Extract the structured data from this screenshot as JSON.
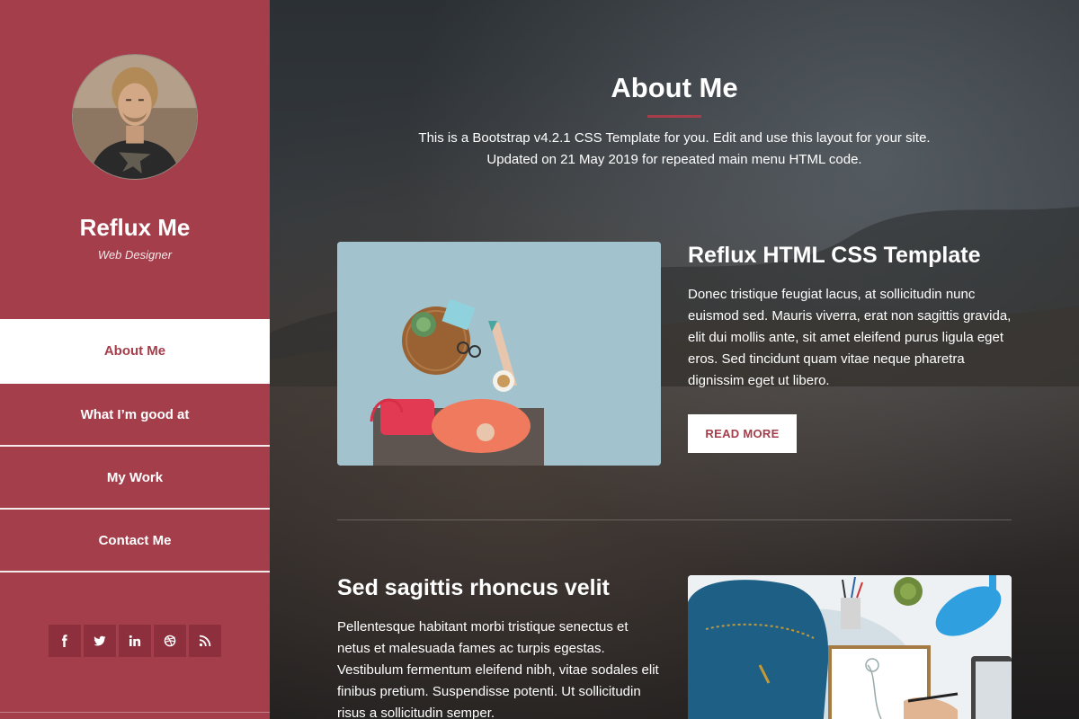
{
  "sidebar": {
    "name": "Reflux Me",
    "role": "Web Designer",
    "nav": [
      {
        "label": "About Me",
        "active": true
      },
      {
        "label": "What I’m good at",
        "active": false
      },
      {
        "label": "My Work",
        "active": false
      },
      {
        "label": "Contact Me",
        "active": false
      }
    ],
    "social_icons": [
      "facebook-icon",
      "twitter-icon",
      "linkedin-icon",
      "dribbble-icon",
      "rss-icon"
    ]
  },
  "main": {
    "title": "About Me",
    "intro_line1": "This is a Bootstrap v4.2.1 CSS Template for you. Edit and use this layout for your site.",
    "intro_line2": "Updated on 21 May 2019 for repeated main menu HTML code.",
    "posts": [
      {
        "title": "Reflux HTML CSS Template",
        "body": "Donec tristique feugiat lacus, at sollicitudin nunc euismod sed. Mauris viverra, erat non sagittis gravida, elit dui mollis ante, sit amet eleifend purus ligula eget eros. Sed tincidunt quam vitae neque pharetra dignissim eget ut libero.",
        "button": "READ MORE"
      },
      {
        "title": "Sed sagittis rhoncus velit",
        "body": "Pellentesque habitant morbi tristique senectus et netus et malesuada fames ac turpis egestas. Vestibulum fermentum eleifend nibh, vitae sodales elit finibus pretium. Suspendisse potenti. Ut sollicitudin risus a sollicitudin semper."
      }
    ]
  },
  "colors": {
    "accent": "#a43e4b",
    "accent_dark": "#8d2f3c",
    "main_bg": "#2b3034"
  }
}
